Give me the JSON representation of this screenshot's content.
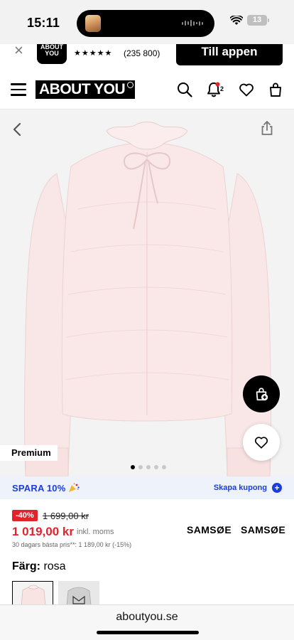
{
  "status_bar": {
    "time": "15:11",
    "battery": "13"
  },
  "app_banner": {
    "logo_text": "ABOUT YOU",
    "stars": "★★★★★",
    "rating_count": "(235 800)",
    "cta_label": "Till appen"
  },
  "header": {
    "logo_text": "ABOUT YOU",
    "notification_count": "2",
    "icons": [
      "menu-icon",
      "search-icon",
      "bell-icon",
      "heart-icon",
      "bag-icon"
    ]
  },
  "gallery": {
    "badge": "Premium",
    "image_count": 5,
    "active_index": 0,
    "product_color_hex": "#f8e3e3"
  },
  "discount": {
    "save_text": "SPARA 10%",
    "coupon_label": "Skapa kupong",
    "accent_color": "#1a3edb"
  },
  "price": {
    "discount_badge": "-40%",
    "old_price": "1 699,00 kr",
    "new_price": "1 019,00 kr",
    "vat_note": "inkl. moms",
    "lowest_price_note": "30 dagars bästa pris**: 1 189,00 kr (-15%)",
    "sale_color": "#e0242c"
  },
  "brands": [
    "SAMSØE",
    "SAMSØE"
  ],
  "color": {
    "label": "Färg:",
    "value": "rosa",
    "swatches": [
      "rosa",
      "grå"
    ]
  },
  "browser": {
    "url": "aboutyou.se"
  }
}
